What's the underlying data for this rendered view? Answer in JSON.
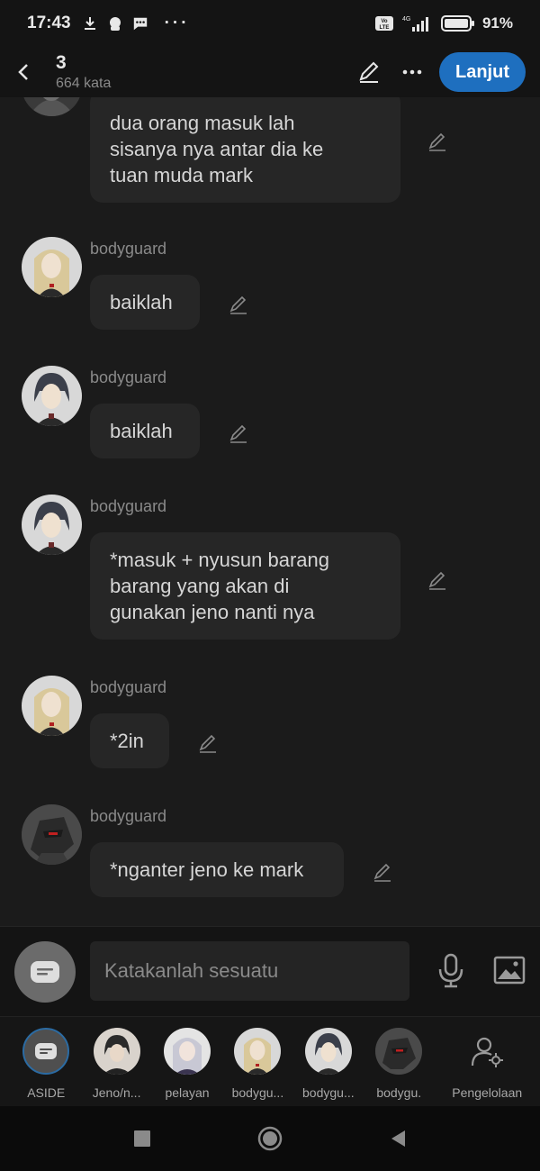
{
  "status_bar": {
    "time": "17:43",
    "network": "4G",
    "battery": "91%"
  },
  "header": {
    "title": "3",
    "subtitle": "664 kata",
    "next_label": "Lanjut"
  },
  "messages": [
    {
      "speaker": "",
      "avatar": "hooded-character",
      "lines": [
        "dua orang masuk lah",
        "sisanya nya antar dia ke",
        "tuan muda mark"
      ]
    },
    {
      "speaker": "bodyguard",
      "avatar": "blonde-character",
      "lines": [
        "baiklah"
      ]
    },
    {
      "speaker": "bodyguard",
      "avatar": "dark-haired-character",
      "lines": [
        "baiklah"
      ]
    },
    {
      "speaker": "bodyguard",
      "avatar": "dark-haired-character",
      "lines": [
        "*masuk + nyusun barang",
        "barang yang akan di",
        "gunakan jeno nanti nya"
      ]
    },
    {
      "speaker": "bodyguard",
      "avatar": "blonde-character",
      "lines": [
        "*2in"
      ]
    },
    {
      "speaker": "bodyguard",
      "avatar": "armored-character",
      "lines": [
        "*nganter jeno ke mark"
      ]
    }
  ],
  "input": {
    "placeholder": "Katakanlah sesuatu"
  },
  "characters": [
    {
      "label": "ASIDE",
      "avatar": "aside-icon"
    },
    {
      "label": "Jeno/n...",
      "avatar": "dark-haired-character"
    },
    {
      "label": "pelayan",
      "avatar": "silver-haired-character"
    },
    {
      "label": "bodygu...",
      "avatar": "blonde-character"
    },
    {
      "label": "bodygu...",
      "avatar": "dark-haired-character"
    },
    {
      "label": "bodygu.",
      "avatar": "armored-character"
    }
  ],
  "manage_label": "Pengelolaan",
  "colors": {
    "background": "#1b1b1b",
    "bubble": "#262626",
    "accent": "#1e6fbf",
    "speaker_text": "#8a8a8a"
  }
}
